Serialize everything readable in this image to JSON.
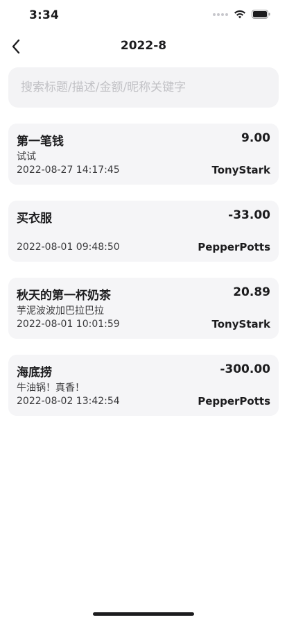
{
  "status_bar": {
    "time": "3:34",
    "icons": [
      "cellular-dots-icon",
      "wifi-icon",
      "battery-icon"
    ]
  },
  "nav": {
    "back_icon": "chevron-left-icon",
    "title": "2022-8"
  },
  "search": {
    "placeholder": "搜索标题/描述/金额/昵称关键字",
    "value": ""
  },
  "records": [
    {
      "title": "第一笔钱",
      "amount": "9.00",
      "description": "试试",
      "time": "2022-08-27 14:17:45",
      "nickname": "TonyStark"
    },
    {
      "title": "买衣服",
      "amount": "-33.00",
      "description": "",
      "time": "2022-08-01 09:48:50",
      "nickname": "PepperPotts"
    },
    {
      "title": "秋天的第一杯奶茶",
      "amount": "20.89",
      "description": "芋泥波波加巴拉巴拉",
      "time": "2022-08-01 10:01:59",
      "nickname": "TonyStark"
    },
    {
      "title": "海底捞",
      "amount": "-300.00",
      "description": "牛油锅！真香！",
      "time": "2022-08-02 13:42:54",
      "nickname": "PepperPotts"
    }
  ],
  "colors": {
    "card_background": "#f5f5f7",
    "search_background": "#f3f3f5",
    "text_primary": "#1c1c1e",
    "placeholder": "#c2c2c6"
  }
}
